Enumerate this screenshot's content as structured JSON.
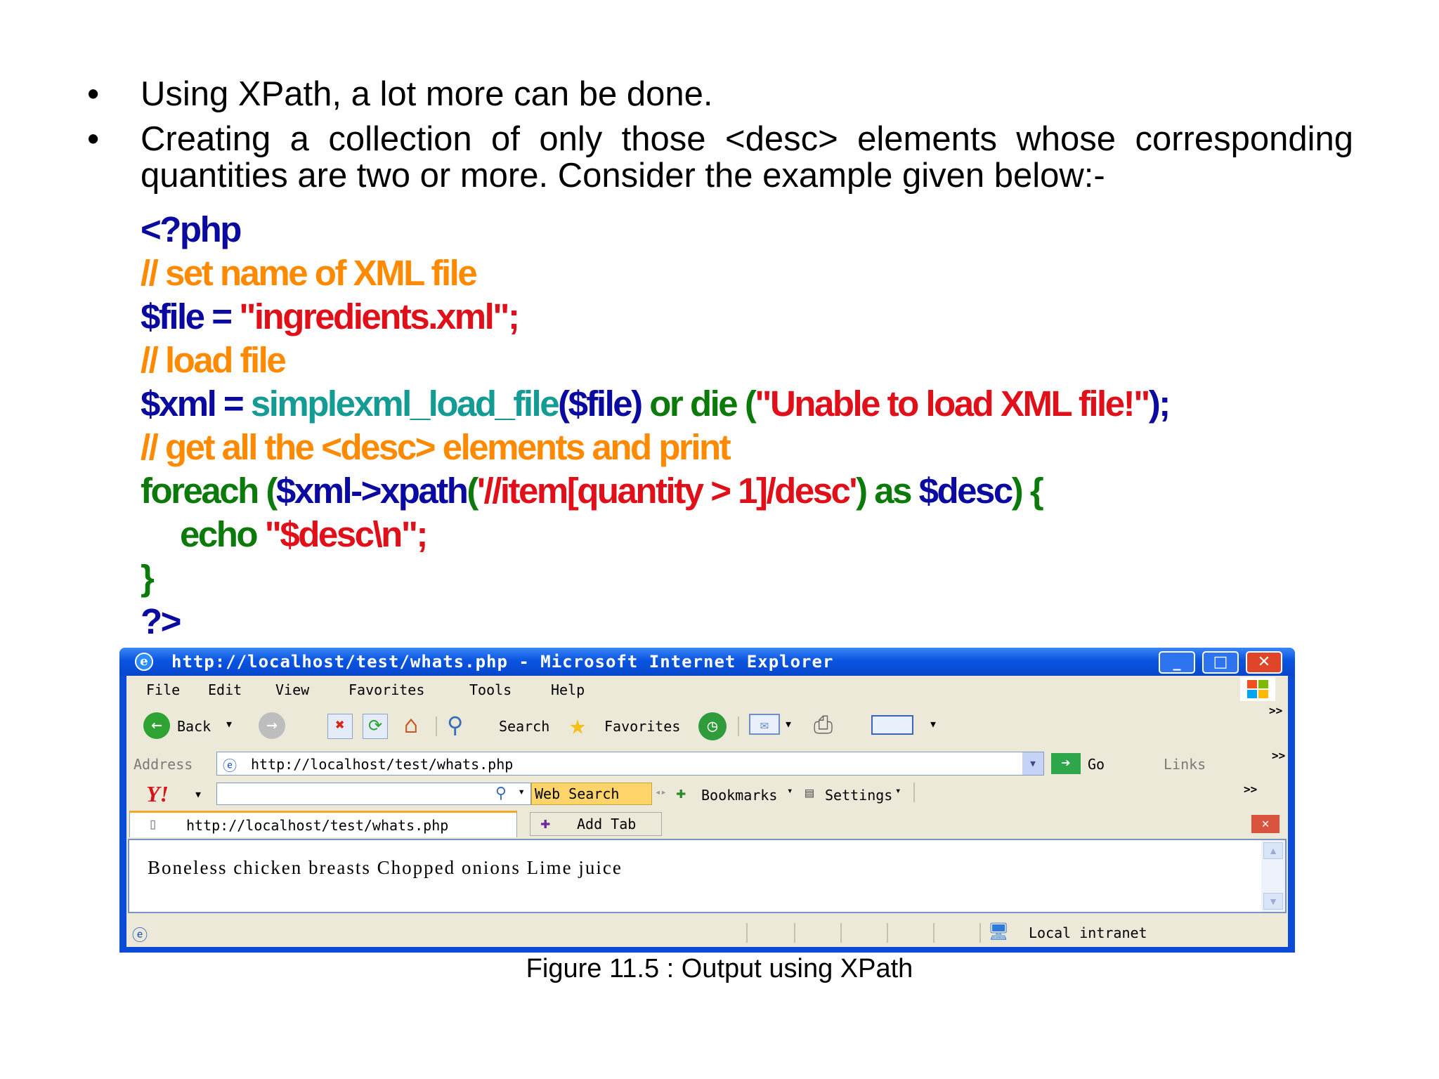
{
  "bullets": [
    "Using XPath, a lot more can be done.",
    "Creating a collection of only those <desc> elements whose corresponding quantities are two or more. Consider the example given below:-"
  ],
  "bullet_symbol": "•",
  "code": {
    "l1": "<?php",
    "l2": "// set name of XML file",
    "l3_var": "$file",
    "l3_eq": " = ",
    "l3_str": "\"ingredients.xml\";",
    "l4": "// load file",
    "l5_var": "$xml",
    "l5_eq": " = ",
    "l5_fn": "simplexml_load_file",
    "l5_p1": "(",
    "l5_arg": "$file",
    "l5_p2": ") ",
    "l5_or": "or die ",
    "l5_p3": "(",
    "l5_str": "\"Unable to load XML file!\"",
    "l5_end": ");",
    "l6": "// get all the <desc> elements and print",
    "l7_kw": "foreach (",
    "l7_var": "$xml->xpath",
    "l7_p": "(",
    "l7_str": "'//item[quantity > 1]/desc'",
    "l7_as": ") as ",
    "l7_var2": "$desc",
    "l7_end": ") {",
    "l8_kw": "echo ",
    "l8_str": "\"$desc\\n\";",
    "l9": "}",
    "l10": "?>"
  },
  "browser": {
    "title": "http://localhost/test/whats.php - Microsoft Internet Explorer",
    "menu": [
      "File",
      "Edit",
      "View",
      "Favorites",
      "Tools",
      "Help"
    ],
    "toolbar": {
      "back": "Back",
      "search": "Search",
      "favorites": "Favorites"
    },
    "address_label": "Address",
    "address_value": "http://localhost/test/whats.php",
    "go_label": "Go",
    "links_label": "Links",
    "chevrons": ">>",
    "yahoo_logo": "Y!",
    "web_search": "Web Search",
    "bookmarks": "Bookmarks",
    "settings": "Settings",
    "tab_title": "http://localhost/test/whats.php",
    "add_tab": "Add Tab",
    "page_content": "Boneless chicken breasts Chopped onions Lime juice",
    "status_zone": "Local intranet",
    "win_min": "_",
    "win_max": "□",
    "win_close": "✕"
  },
  "caption": "Figure 11.5 : Output using XPath"
}
